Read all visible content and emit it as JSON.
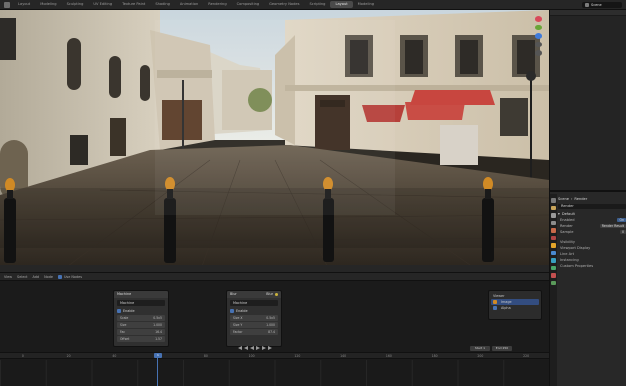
{
  "topbar": {
    "workspaces": [
      "Layout",
      "Modeling",
      "Sculpting",
      "UV Editing",
      "Texture Paint",
      "Shading",
      "Animation",
      "Rendering",
      "Compositing",
      "Geometry Nodes",
      "Scripting",
      "Layout",
      "Modeling"
    ],
    "active_index": 11,
    "scene_name": "Scene"
  },
  "properties": {
    "header_label": "Scene",
    "object_label": "Render",
    "name_field": "Render",
    "section": "Default",
    "rows": [
      {
        "label": "Enabled",
        "value": "On"
      },
      {
        "label": "Render",
        "value": "Render Result"
      },
      {
        "label": "Sample",
        "value": "0"
      }
    ],
    "list": [
      "Visibility",
      "Viewport Display",
      "Line Art",
      "Instancing",
      "Custom Properties"
    ]
  },
  "bottom": {
    "header_items": [
      "View",
      "Select",
      "Add",
      "Node",
      "Use Nodes"
    ],
    "node_a": {
      "title": "Machine",
      "field": "Machine",
      "checkbox_label": "Enable",
      "rows": [
        {
          "k": "Scale",
          "v": "0.5x5"
        },
        {
          "k": "Size",
          "v": "1.000"
        },
        {
          "k": "Fac",
          "v": "16.4"
        },
        {
          "k": "Offset",
          "v": "1.57"
        }
      ]
    },
    "node_b": {
      "title": "Blur",
      "right_label": "Blur",
      "field": "Machine",
      "checkbox_label": "Enable",
      "rows": [
        {
          "k": "Size X",
          "v": "0.5x5"
        },
        {
          "k": "Size Y",
          "v": "1.000"
        },
        {
          "k": "Factor",
          "v": "87.4"
        }
      ]
    },
    "mini_panel": {
      "items": [
        "Viewer",
        "Image",
        "Alpha"
      ]
    },
    "ruler_ticks": [
      "0",
      "20",
      "40",
      "60",
      "80",
      "100",
      "120",
      "140",
      "160",
      "180",
      "200",
      "220"
    ],
    "current_frame": "1",
    "frame_fields": [
      "Start 1",
      "End 250"
    ]
  },
  "colors": {
    "accent": "#4772b3",
    "socket": "#cbb33c"
  }
}
